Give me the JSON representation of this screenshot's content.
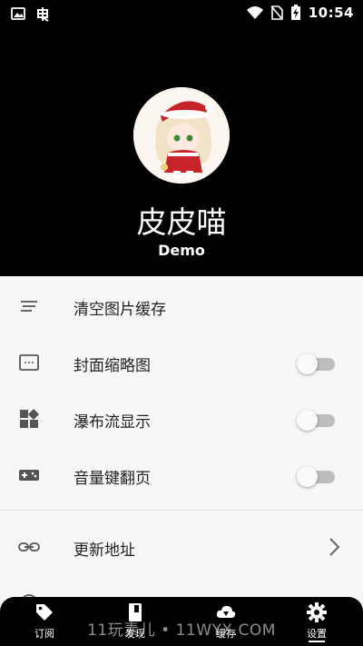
{
  "status_bar": {
    "time": "10:54"
  },
  "profile": {
    "name": "皮皮喵",
    "id": "Demo"
  },
  "settings": {
    "items": [
      {
        "label": "清空图片缓存",
        "icon": "clear-list-icon",
        "control": "none"
      },
      {
        "label": "封面缩略图",
        "icon": "thumbnail-icon",
        "control": "toggle",
        "on": false
      },
      {
        "label": "瀑布流显示",
        "icon": "waterfall-grid-icon",
        "control": "toggle",
        "on": false
      },
      {
        "label": "音量键翻页",
        "icon": "gamepad-icon",
        "control": "toggle",
        "on": false
      },
      {
        "label": "更新地址",
        "icon": "link-icon",
        "control": "chevron"
      }
    ]
  },
  "bottom_nav": {
    "items": [
      {
        "label": "订阅",
        "icon": "tag-icon"
      },
      {
        "label": "发现",
        "icon": "book-icon"
      },
      {
        "label": "缓存",
        "icon": "cloud-download-icon"
      },
      {
        "label": "设置",
        "icon": "gear-icon",
        "active": true
      }
    ]
  },
  "watermark": "11玩素儿 • 11WYX.COM",
  "colors": {
    "header_bg": "#000000",
    "content_bg": "#f7f7f7",
    "toggle_track": "#bdbdbd"
  }
}
